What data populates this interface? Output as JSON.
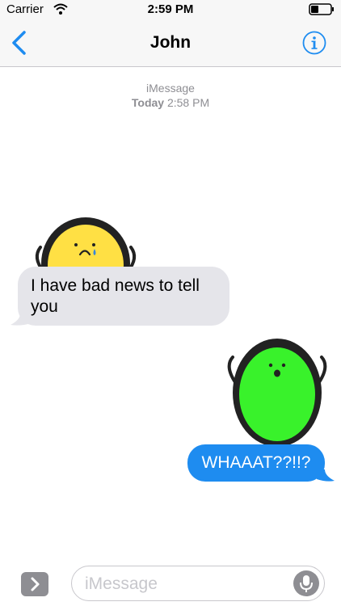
{
  "status_bar": {
    "carrier": "Carrier",
    "time": "2:59 PM"
  },
  "nav": {
    "title": "John"
  },
  "thread_meta": {
    "service": "iMessage",
    "day": "Today",
    "time": "2:58 PM"
  },
  "messages": [
    {
      "direction": "incoming",
      "text": "I have bad news to tell you",
      "sticker": "sad-yellow-blob"
    },
    {
      "direction": "outgoing",
      "text": "WHAAAT??!!?",
      "sticker": "shocked-green-blob"
    }
  ],
  "composer": {
    "placeholder": "iMessage"
  },
  "colors": {
    "accent": "#1e8cf0",
    "incoming_bubble": "#e5e5ea",
    "yellow_sticker": "#ffe044",
    "green_sticker": "#39f22b"
  }
}
